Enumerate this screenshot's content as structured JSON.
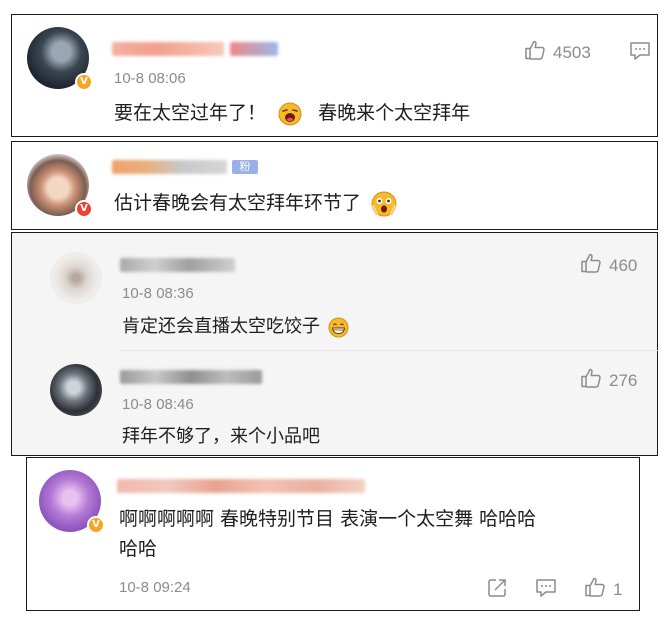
{
  "colors": {
    "vip_badge": "#f5a623",
    "red_badge": "#e8432f",
    "name_blur_orange": "#f3a99a",
    "name_blur_gray": "#b9b9b9",
    "meta_gray": "#8c8c8c"
  },
  "comments": [
    {
      "time": "10-8 08:06",
      "text": "要在太空过年了！",
      "text_after_emoji": "春晚来个太空拜年",
      "likes": "4503",
      "emoji": "laughing-emoji",
      "badge": "V"
    },
    {
      "time": "",
      "text": "估计春晚会有太空拜年环节了",
      "emoji": "shocked-emoji",
      "badge": "V",
      "fan_tag": "粉"
    },
    {
      "time": "10-8 08:36",
      "text": "肯定还会直播太空吃饺子",
      "likes": "460",
      "emoji": "grinning-emoji"
    },
    {
      "time": "10-8 08:46",
      "text": "拜年不够了，来个小品吧",
      "likes": "276"
    },
    {
      "time": "10-8 09:24",
      "text_line1": "啊啊啊啊啊 春晚特别节目 表演一个太空舞 哈哈哈",
      "text_line2": "哈哈",
      "likes": "1",
      "badge": "V"
    }
  ]
}
